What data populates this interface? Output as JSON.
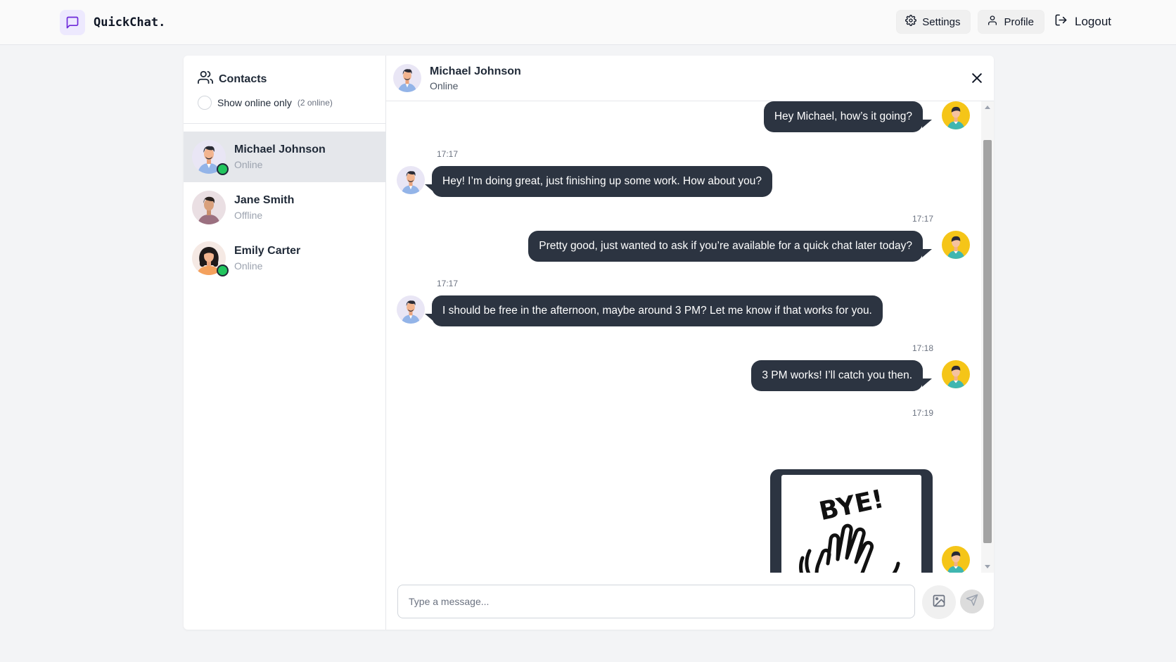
{
  "app": {
    "name": "QuickChat."
  },
  "nav": {
    "settings_label": "Settings",
    "profile_label": "Profile",
    "logout_label": "Logout"
  },
  "sidebar": {
    "title": "Contacts",
    "online_filter_label": "Show online only",
    "online_count": "(2 online)",
    "contacts": [
      {
        "name": "Michael Johnson",
        "status": "Online"
      },
      {
        "name": "Jane Smith",
        "status": "Offline"
      },
      {
        "name": "Emily Carter",
        "status": "Online"
      }
    ]
  },
  "chat": {
    "contact_name": "Michael Johnson",
    "contact_status": "Online",
    "messages": [
      {
        "from": "me",
        "text": "Hey Michael, how’s it going?",
        "time": ""
      },
      {
        "from": "them",
        "text": "Hey! I’m doing great, just finishing up some work. How about you?",
        "time": "17:17"
      },
      {
        "from": "me",
        "text": "Pretty good, just wanted to ask if you’re available for a quick chat later today?",
        "time": "17:17"
      },
      {
        "from": "them",
        "text": "I should be free in the afternoon, maybe around 3 PM? Let me know if that works for you.",
        "time": "17:17"
      },
      {
        "from": "me",
        "text": "3 PM works! I’ll catch you then.",
        "time": "17:18"
      },
      {
        "from": "me",
        "type": "image",
        "sticker_text": "BYE!",
        "time": "17:19"
      }
    ],
    "input_placeholder": "Type a message..."
  },
  "colors": {
    "bubble": "#2c3441",
    "online": "#22c55e",
    "brand_bg": "#ede9fe",
    "brand_icon": "#6d28d9"
  }
}
